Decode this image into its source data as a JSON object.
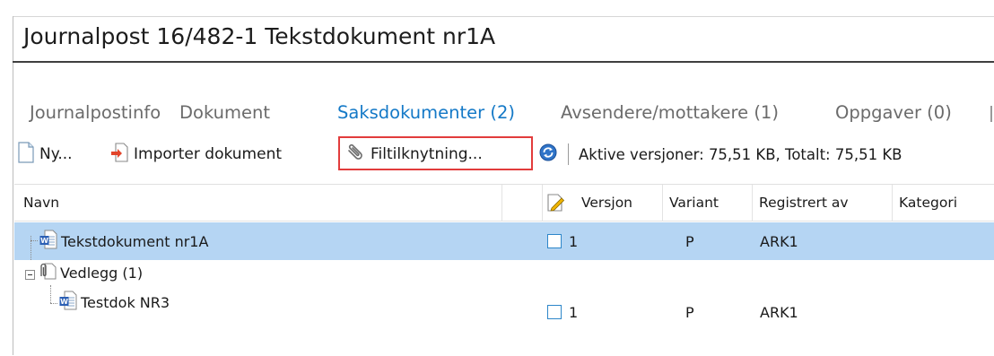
{
  "window": {
    "title": "Journalpost 16/482-1 Tekstdokument nr1A"
  },
  "tabs": [
    {
      "label": "Journalpostinfo",
      "active": false
    },
    {
      "label": "Dokument",
      "active": false
    },
    {
      "label": "Saksdokumenter (2)",
      "active": true
    },
    {
      "label": "Avsendere/mottakere (1)",
      "active": false
    },
    {
      "label": "Oppgaver (0)",
      "active": false
    }
  ],
  "toolbar": {
    "new_label": "Ny...",
    "import_label": "Importer dokument",
    "link_label": "Filtilknytning...",
    "status": "Aktive versjoner: 75,51 KB,  Totalt: 75,51 KB"
  },
  "grid": {
    "columns": {
      "name": "Navn",
      "version": "Versjon",
      "variant": "Variant",
      "registered_by": "Registrert av",
      "category": "Kategori"
    },
    "rows": [
      {
        "name": "Tekstdokument nr1A",
        "version": "1",
        "variant": "P",
        "registered_by": "ARK1",
        "selected": true
      },
      {
        "name": "Vedlegg (1)",
        "group": true
      },
      {
        "name": "Testdok NR3",
        "version": "1",
        "variant": "P",
        "registered_by": "ARK1",
        "selected": false
      }
    ]
  },
  "colors": {
    "accent": "#1479c7",
    "selection": "#b5d5f3",
    "highlight_box": "#e23c3c"
  },
  "icons": [
    "new-document-icon",
    "import-icon",
    "paperclip-icon",
    "refresh-icon",
    "edit-document-icon",
    "word-document-icon",
    "attachment-folder-icon"
  ]
}
